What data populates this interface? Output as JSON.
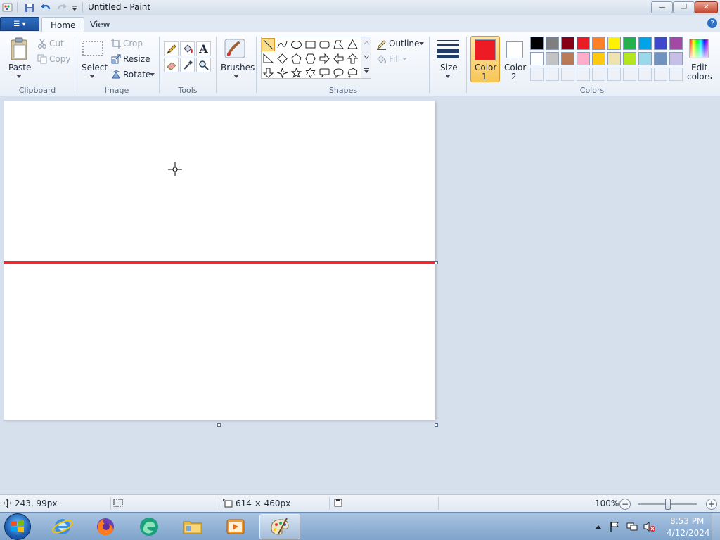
{
  "window": {
    "title": "Untitled - Paint",
    "minimize_label": "—",
    "maximize_label": "❐",
    "close_label": "✕"
  },
  "tabs": {
    "file_label": "☰ ▾",
    "home": "Home",
    "view": "View",
    "help": "?"
  },
  "clipboard": {
    "paste": "Paste",
    "cut": "Cut",
    "copy": "Copy",
    "group": "Clipboard"
  },
  "image": {
    "select": "Select",
    "crop": "Crop",
    "resize": "Resize",
    "rotate": "Rotate",
    "group": "Image"
  },
  "tools": {
    "group": "Tools",
    "text_glyph": "A"
  },
  "brushes": {
    "label": "Brushes"
  },
  "shapes": {
    "group": "Shapes",
    "outline": "Outline",
    "fill": "Fill"
  },
  "size": {
    "label": "Size"
  },
  "colors": {
    "group": "Colors",
    "color1_line1": "Color",
    "color1_line2": "1",
    "color2_line1": "Color",
    "color2_line2": "2",
    "edit_line1": "Edit",
    "edit_line2": "colors",
    "color1_value": "#ed1c24",
    "color2_value": "#ffffff",
    "palette": [
      "#000000",
      "#7f7f7f",
      "#880015",
      "#ed1c24",
      "#ff7f27",
      "#fff200",
      "#22b14c",
      "#00a2e8",
      "#3f48cc",
      "#a349a4",
      "#ffffff",
      "#c3c3c3",
      "#b97a57",
      "#ffaec9",
      "#ffc90e",
      "#efe4b0",
      "#b5e61d",
      "#99d9ea",
      "#7092be",
      "#c8bfe7"
    ]
  },
  "canvas": {
    "line_color": "#e03036",
    "cursor": "crosshair"
  },
  "status": {
    "position": "243, 99px",
    "size": "614 × 460px",
    "zoom": "100%",
    "zoom_out": "−",
    "zoom_in": "+"
  },
  "taskbar": {
    "time": "8:53 PM",
    "date": "4/12/2024"
  }
}
